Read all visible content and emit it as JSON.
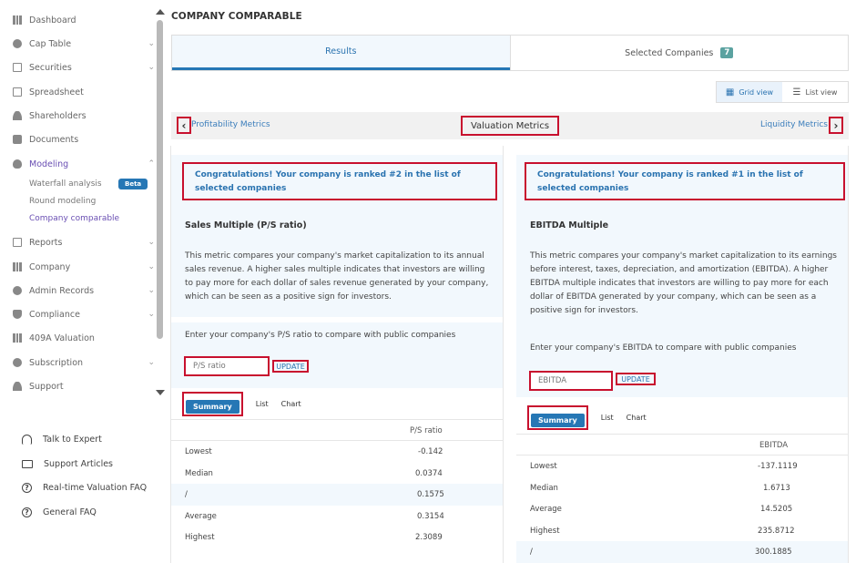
{
  "sidebar": {
    "items": [
      {
        "label": "Dashboard",
        "icon": "dashboard-icon",
        "chevron": false
      },
      {
        "label": "Cap Table",
        "icon": "pie-chart-icon",
        "chevron": true
      },
      {
        "label": "Securities",
        "icon": "document-icon",
        "chevron": true
      },
      {
        "label": "Spreadsheet",
        "icon": "spreadsheet-icon",
        "chevron": false
      },
      {
        "label": "Shareholders",
        "icon": "user-icon",
        "chevron": false
      },
      {
        "label": "Documents",
        "icon": "folder-icon",
        "chevron": false
      },
      {
        "label": "Modeling",
        "icon": "bulb-icon",
        "chevron": true
      },
      {
        "label": "Reports",
        "icon": "report-icon",
        "chevron": true
      },
      {
        "label": "Company",
        "icon": "building-icon",
        "chevron": true
      },
      {
        "label": "Admin Records",
        "icon": "gear-icon",
        "chevron": true
      },
      {
        "label": "Compliance",
        "icon": "shield-icon",
        "chevron": true
      },
      {
        "label": "409A Valuation",
        "icon": "chart-icon",
        "chevron": false
      },
      {
        "label": "Subscription",
        "icon": "dollar-icon",
        "chevron": true
      },
      {
        "label": "Support",
        "icon": "support-icon",
        "chevron": false
      }
    ],
    "modeling_sub": {
      "waterfall": "Waterfall analysis",
      "beta": "Beta",
      "round": "Round modeling",
      "comparable": "Company comparable"
    },
    "help": [
      {
        "label": "Talk to Expert"
      },
      {
        "label": "Support Articles"
      },
      {
        "label": "Real-time Valuation FAQ"
      },
      {
        "label": "General FAQ"
      }
    ]
  },
  "page": {
    "title": "COMPANY COMPARABLE",
    "tabs": {
      "results": "Results",
      "selected": "Selected Companies",
      "selected_count": "7"
    },
    "view": {
      "grid": "Grid view",
      "list": "List view"
    },
    "metrics": {
      "prev": "Profitability Metrics",
      "current": "Valuation Metrics",
      "next": "Liquidity Metrics"
    }
  },
  "left": {
    "congrats": "Congratulations! Your company is ranked #2 in the list of selected companies",
    "title": "Sales Multiple (P/S ratio)",
    "description": "This metric compares your company's market capitalization to its annual sales revenue. A higher sales multiple indicates that investors are willing to pay more for each dollar of sales revenue generated by your company, which can be seen as a positive sign for investors.",
    "input_label": "Enter your company's P/S ratio to compare with public companies",
    "input_placeholder": "P/S ratio",
    "update": "UPDATE",
    "subtabs": {
      "summary": "Summary",
      "list": "List",
      "chart": "Chart"
    },
    "column": "P/S ratio",
    "rows": [
      {
        "label": "Lowest",
        "value": "-0.142"
      },
      {
        "label": "Median",
        "value": "0.0374"
      },
      {
        "label": "/",
        "value": "0.1575"
      },
      {
        "label": "Average",
        "value": "0.3154"
      },
      {
        "label": "Highest",
        "value": "2.3089"
      }
    ]
  },
  "right": {
    "congrats": "Congratulations! Your company is ranked #1 in the list of selected companies",
    "title": "EBITDA Multiple",
    "description": "This metric compares your company's market capitalization to its earnings before interest, taxes, depreciation, and amortization (EBITDA). A higher EBITDA multiple indicates that investors are willing to pay more for each dollar of EBITDA generated by your company, which can be seen as a positive sign for investors.",
    "input_label": "Enter your company's EBITDA to compare with public companies",
    "input_placeholder": "EBITDA",
    "update": "UPDATE",
    "subtabs": {
      "summary": "Summary",
      "list": "List",
      "chart": "Chart"
    },
    "column": "EBITDA",
    "rows": [
      {
        "label": "Lowest",
        "value": "-137.1119"
      },
      {
        "label": "Median",
        "value": "1.6713"
      },
      {
        "label": "Average",
        "value": "14.5205"
      },
      {
        "label": "Highest",
        "value": "235.8712"
      },
      {
        "label": "/",
        "value": "300.1885"
      }
    ]
  },
  "colors": {
    "accent": "#2677b5",
    "active_nav": "#6a4fb3",
    "highlight": "#c8102e",
    "badge": "#5ba2a0"
  }
}
